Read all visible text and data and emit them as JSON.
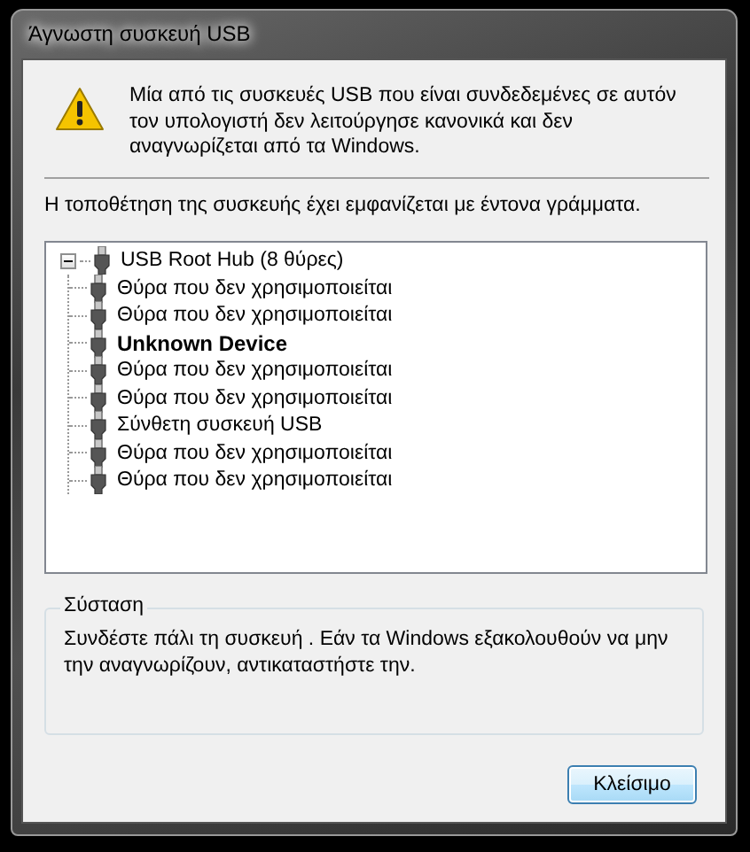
{
  "window": {
    "title": "Άγνωστη συσκευή USB"
  },
  "message": "Μία από τις συσκευές USB που είναι συνδεδεμένες σε αυτόν τον υπολογιστή δεν λειτούργησε κανονικά και δεν αναγνωρίζεται από τα Windows.",
  "hint": "Η τοποθέτηση της συσκευής έχει εμφανίζεται με έντονα γράμματα.",
  "tree": {
    "label": "USB Root Hub (8 θύρες)",
    "expanded": true,
    "children": [
      {
        "label": "Θύρα που δεν χρησιμοποιείται",
        "bold": false
      },
      {
        "label": "Θύρα που δεν χρησιμοποιείται",
        "bold": false
      },
      {
        "label": "Unknown Device",
        "bold": true
      },
      {
        "label": "Θύρα που δεν χρησιμοποιείται",
        "bold": false
      },
      {
        "label": "Θύρα που δεν χρησιμοποιείται",
        "bold": false
      },
      {
        "label": "Σύνθετη συσκευή USB",
        "bold": false
      },
      {
        "label": "Θύρα που δεν χρησιμοποιείται",
        "bold": false
      },
      {
        "label": "Θύρα που δεν χρησιμοποιείται",
        "bold": false
      }
    ]
  },
  "recommendation": {
    "title": "Σύσταση",
    "text": "Συνδέστε πάλι τη συσκευή . Εάν τα Windows εξακολουθούν να μην την αναγνωρίζουν, αντικαταστήστε την."
  },
  "buttons": [
    "Κλείσιμο"
  ]
}
